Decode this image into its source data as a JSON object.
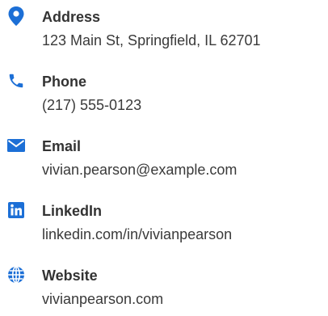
{
  "accent_color": "#1c6fd6",
  "contacts": [
    {
      "icon": "map-marker-icon",
      "label": "Address",
      "value": "123 Main St, Springfield, IL 62701"
    },
    {
      "icon": "phone-icon",
      "label": "Phone",
      "value": "(217) 555-0123"
    },
    {
      "icon": "envelope-icon",
      "label": "Email",
      "value": "vivian.pearson@example.com"
    },
    {
      "icon": "linkedin-icon",
      "label": "LinkedIn",
      "value": "linkedin.com/in/vivianpearson"
    },
    {
      "icon": "globe-icon",
      "label": "Website",
      "value": "vivianpearson.com"
    }
  ]
}
